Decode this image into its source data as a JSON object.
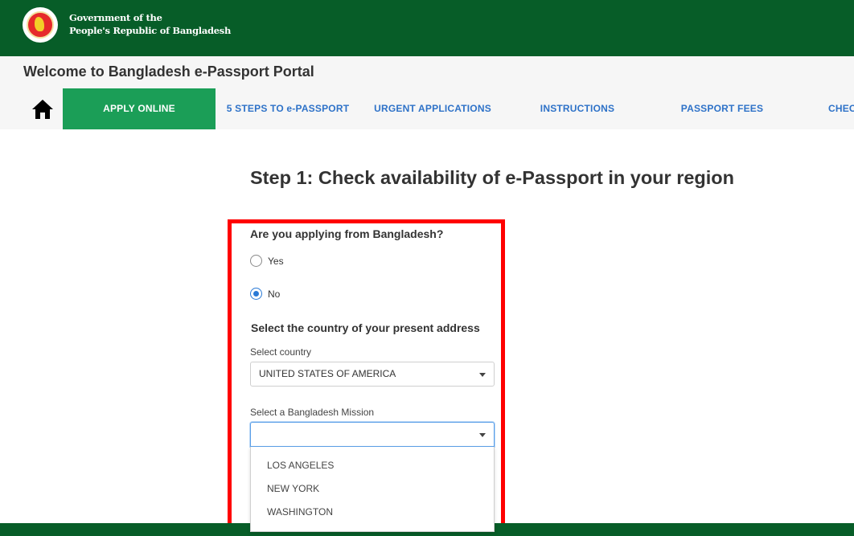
{
  "gov_header": {
    "title_line1": "Government of the",
    "title_line2": "People's Republic of Bangladesh",
    "emblem": "bangladesh-emblem"
  },
  "portal": {
    "title": "Welcome to Bangladesh e-Passport Portal"
  },
  "nav": {
    "home_icon": "home-icon",
    "items": [
      {
        "label": "APPLY ONLINE",
        "active": true
      },
      {
        "label": "5 STEPS TO e-PASSPORT",
        "active": false
      },
      {
        "label": "URGENT APPLICATIONS",
        "active": false
      },
      {
        "label": "INSTRUCTIONS",
        "active": false
      },
      {
        "label": "PASSPORT FEES",
        "active": false
      },
      {
        "label": "CHEC",
        "active": false
      }
    ]
  },
  "step": {
    "title": "Step 1: Check availability of e-Passport in your region"
  },
  "form": {
    "question": "Are you applying from Bangladesh?",
    "options": [
      {
        "label": "Yes",
        "checked": false
      },
      {
        "label": "No",
        "checked": true
      }
    ],
    "country_section": "Select the country of your present address",
    "country_label": "Select country",
    "country_value": "UNITED STATES OF AMERICA",
    "mission_label": "Select a Bangladesh Mission",
    "mission_value": "",
    "mission_options": [
      "LOS ANGELES",
      "NEW YORK",
      "WASHINGTON"
    ]
  },
  "colors": {
    "header_green": "#075d28",
    "active_tab": "#1b9e57",
    "nav_link": "#2e72c8",
    "highlight": "#ff0000",
    "radio_selected": "#2a7ad6"
  }
}
